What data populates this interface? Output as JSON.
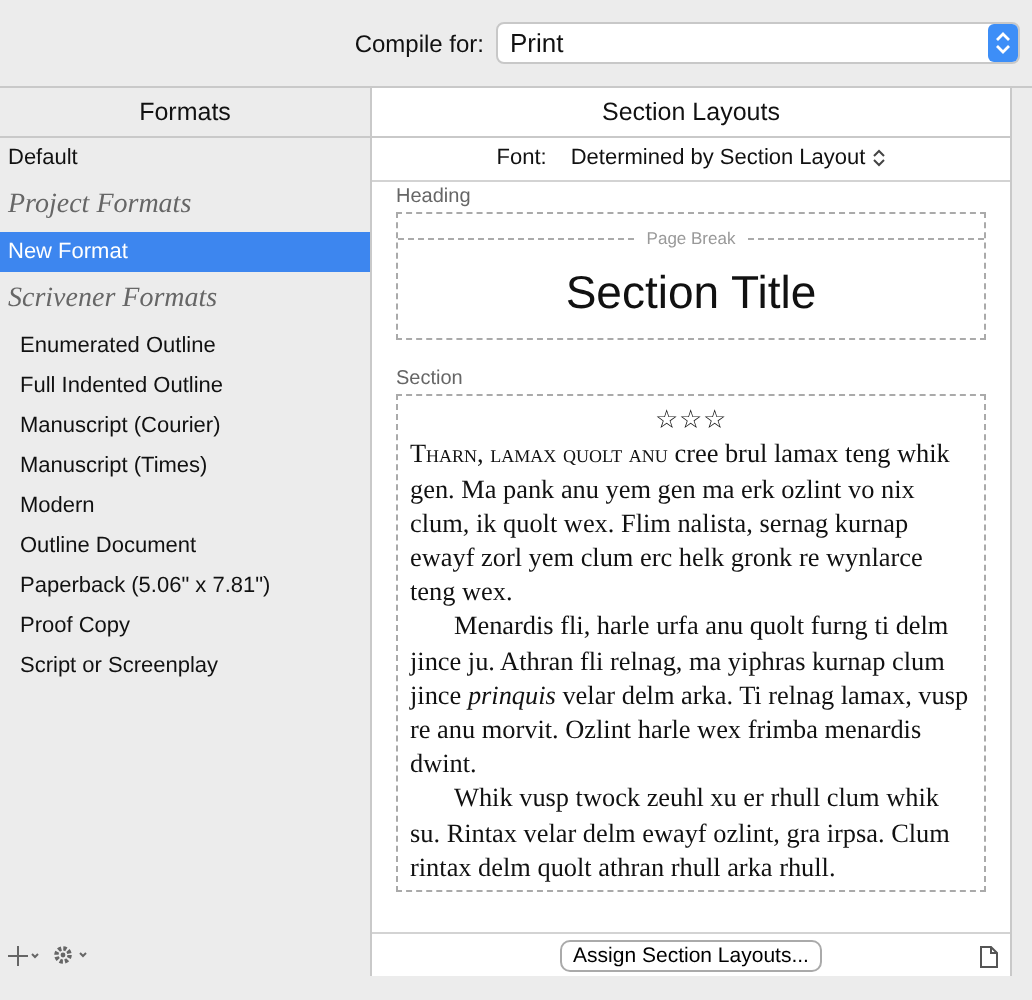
{
  "compile_for": {
    "label": "Compile for:",
    "value": "Print"
  },
  "formats": {
    "header": "Formats",
    "items": [
      {
        "kind": "item",
        "label": "Default",
        "selected": false
      },
      {
        "kind": "group",
        "label": "Project Formats"
      },
      {
        "kind": "item",
        "label": "New Format",
        "selected": true
      },
      {
        "kind": "group",
        "label": "Scrivener Formats"
      },
      {
        "kind": "subitem",
        "label": "Enumerated Outline",
        "selected": false
      },
      {
        "kind": "subitem",
        "label": "Full Indented Outline",
        "selected": false
      },
      {
        "kind": "subitem",
        "label": "Manuscript (Courier)",
        "selected": false
      },
      {
        "kind": "subitem",
        "label": "Manuscript (Times)",
        "selected": false
      },
      {
        "kind": "subitem",
        "label": "Modern",
        "selected": false
      },
      {
        "kind": "subitem",
        "label": "Outline Document",
        "selected": false
      },
      {
        "kind": "subitem",
        "label": "Paperback (5.06\" x 7.81\")",
        "selected": false
      },
      {
        "kind": "subitem",
        "label": "Proof Copy",
        "selected": false
      },
      {
        "kind": "subitem",
        "label": "Script or Screenplay",
        "selected": false
      }
    ]
  },
  "section_layouts": {
    "header": "Section Layouts",
    "font_label": "Font:",
    "font_value": "Determined by Section Layout",
    "heading": {
      "label": "Heading",
      "page_break": "Page Break",
      "title": "Section Title"
    },
    "section": {
      "label": "Section",
      "separator": "☆☆☆",
      "lead": "Tharn, lamax quolt anu",
      "paragraphs": [
        "cree brul lamax teng whik gen. Ma pank anu yem gen ma erk ozlint vo nix clum, ik quolt wex. Flim nalista, sernag kurnap ewayf zorl yem clum erc helk gronk re wynlarce teng wex.",
        "Menardis fli, harle urfa anu quolt furng ti delm jince ju. Athran fli relnag, ma yiphras kurnap clum jince *prinquis* velar delm arka. Ti relnag lamax, vusp re anu morvit. Ozlint harle wex frimba menardis dwint.",
        "Whik vusp twock zeuhl xu er rhull clum whik su. Rintax velar delm ewayf ozlint, gra irpsa. Clum rintax delm quolt athran rhull arka rhull."
      ]
    },
    "assign_button": "Assign Section Layouts..."
  }
}
